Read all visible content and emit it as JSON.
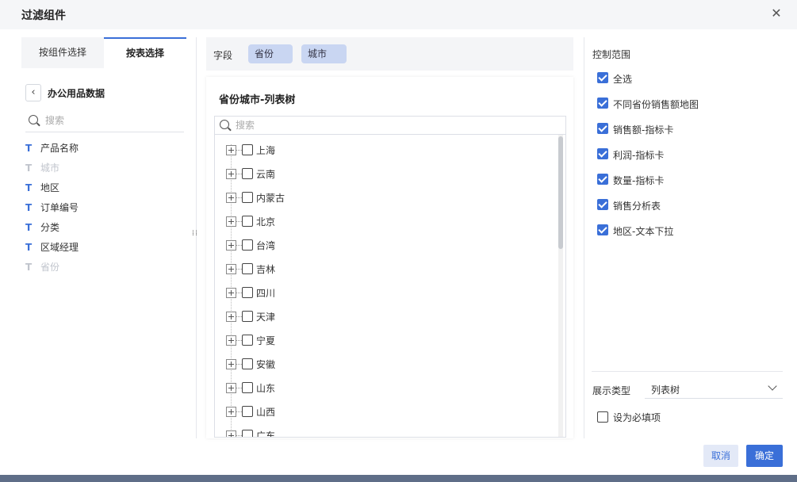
{
  "dialog": {
    "title": "过滤组件",
    "close_symbol": "✕"
  },
  "tabs": [
    {
      "label": "按组件选择",
      "active": false
    },
    {
      "label": "按表选择",
      "active": true
    }
  ],
  "dataset": {
    "back_symbol": "‹",
    "name": "办公用品数据"
  },
  "left_search": {
    "placeholder": "搜索",
    "value": ""
  },
  "fields": [
    {
      "icon": "T",
      "label": "产品名称",
      "enabled": true
    },
    {
      "icon": "T",
      "label": "城市",
      "enabled": false
    },
    {
      "icon": "T",
      "label": "地区",
      "enabled": true
    },
    {
      "icon": "T",
      "label": "订单编号",
      "enabled": true
    },
    {
      "icon": "T",
      "label": "分类",
      "enabled": true
    },
    {
      "icon": "T",
      "label": "区域经理",
      "enabled": true
    },
    {
      "icon": "T",
      "label": "省份",
      "enabled": false
    }
  ],
  "field_bar": {
    "label": "字段",
    "chips": [
      "省份",
      "城市"
    ]
  },
  "tree_card": {
    "title": "省份城市-列表树",
    "search_placeholder": "搜索",
    "items": [
      "上海",
      "云南",
      "内蒙古",
      "北京",
      "台湾",
      "吉林",
      "四川",
      "天津",
      "宁夏",
      "安徽",
      "山东",
      "山西",
      "广东"
    ]
  },
  "control_scope": {
    "title": "控制范围",
    "items": [
      {
        "label": "全选",
        "checked": true
      },
      {
        "label": "不同省份销售额地图",
        "checked": true
      },
      {
        "label": "销售额-指标卡",
        "checked": true
      },
      {
        "label": "利润-指标卡",
        "checked": true
      },
      {
        "label": "数量-指标卡",
        "checked": true
      },
      {
        "label": "销售分析表",
        "checked": true
      },
      {
        "label": "地区-文本下拉",
        "checked": true
      }
    ]
  },
  "display_type": {
    "label": "展示类型",
    "value": "列表树"
  },
  "required": {
    "label": "设为必填项",
    "checked": false
  },
  "buttons": {
    "cancel": "取消",
    "ok": "确定"
  },
  "colors": {
    "accent": "#3a6fd8",
    "chip_bg": "#c9d6f2",
    "disabled_text": "#c0c4cc"
  }
}
